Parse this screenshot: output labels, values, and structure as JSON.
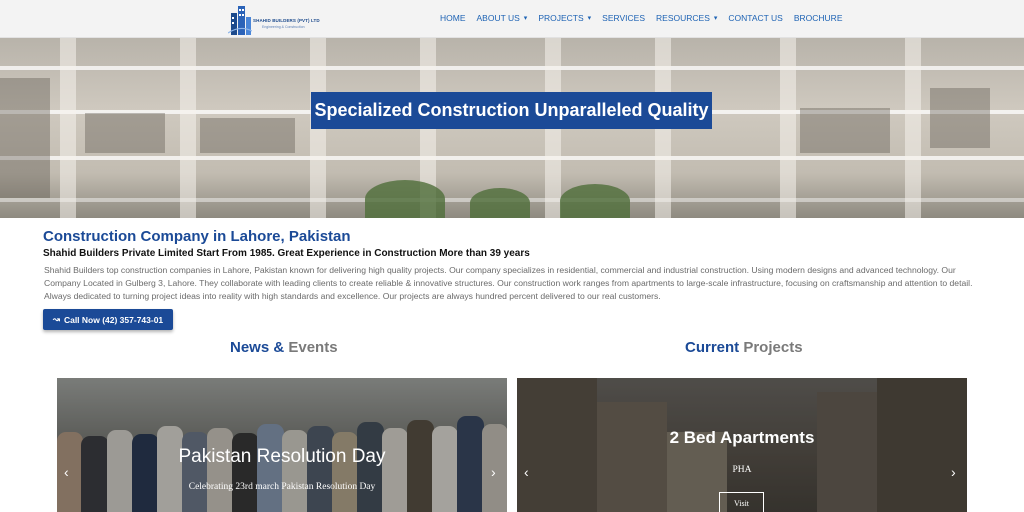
{
  "header": {
    "logo": {
      "name": "SHAHID BUILDERS (PVT) LTD",
      "tagline": "Engineering & Construction"
    },
    "nav": [
      {
        "label": "HOME",
        "dropdown": false
      },
      {
        "label": "ABOUT US",
        "dropdown": true
      },
      {
        "label": "PROJECTS",
        "dropdown": true
      },
      {
        "label": "SERVICES",
        "dropdown": false
      },
      {
        "label": "RESOURCES",
        "dropdown": true
      },
      {
        "label": "CONTACT US",
        "dropdown": false
      },
      {
        "label": "BROCHURE",
        "dropdown": false
      }
    ]
  },
  "hero": {
    "title": "Specialized Construction Unparalleled Quality"
  },
  "intro": {
    "heading": "Construction Company in Lahore, Pakistan",
    "subheading": "Shahid Builders Private Limited Start From 1985. Great Experience in Construction More than 39 years",
    "body": "Shahid Builders top construction companies in Lahore, Pakistan known for delivering high quality projects. Our company specializes in residential, commercial and industrial construction. Using modern designs and advanced technology. Our Company Located in Gulberg 3, Lahore. They collaborate with leading clients to create reliable & innovative structures. Our construction work ranges from apartments to large-scale infrastructure, focusing on craftsmanship and attention to detail. Always dedicated to turning project ideas into reality with high standards and excellence. Our projects are always hundred percent delivered to our real customers.",
    "call_label": "Call Now (42) 357-743-01",
    "call_icon": "phone-icon"
  },
  "news": {
    "title_a": "News",
    "title_amp": " & ",
    "title_b": "Events",
    "slide": {
      "title": "Pakistan Resolution Day",
      "text": "Celebrating 23rd march Pakistan Resolution Day"
    }
  },
  "projects": {
    "title_a": "Current",
    "title_b": " Projects",
    "slide": {
      "title": "2 Bed Apartments",
      "location": "PHA",
      "visit_label": "Visit"
    }
  },
  "colors": {
    "brand_blue": "#1b4a97",
    "nav_blue": "#1e63b4",
    "header_bg": "#f3f3f3",
    "body_text": "#6b6b6b"
  }
}
